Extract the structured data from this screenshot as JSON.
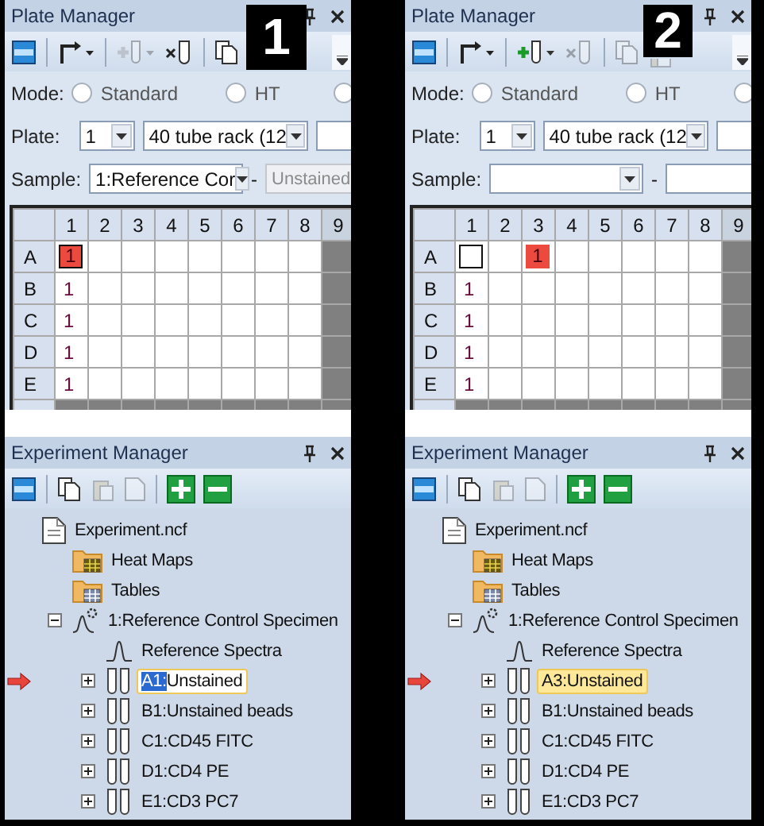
{
  "panels": [
    {
      "badge": "1",
      "plate_manager": {
        "title": "Plate Manager",
        "toolbar": [
          {
            "kind": "layout",
            "disabled": false
          },
          {
            "kind": "route",
            "disabled": false
          },
          {
            "kind": "add-tube",
            "disabled": true
          },
          {
            "kind": "remove-tube",
            "disabled": false
          },
          {
            "kind": "copy",
            "disabled": false
          }
        ],
        "mode": {
          "label": "Mode:",
          "options": [
            {
              "label": "Standard",
              "selected": false
            },
            {
              "label": "HT",
              "selected": false
            },
            {
              "selected": false
            }
          ]
        },
        "plate": {
          "label": "Plate:",
          "number": "1",
          "rack": "40 tube rack (12"
        },
        "sample": {
          "label": "Sample:",
          "value": "1:Reference Cor",
          "separator": "-",
          "tube": {
            "value": "Unstained",
            "disabled": true
          }
        },
        "grid": {
          "columns": [
            {
              "label": "1",
              "disabled": false
            },
            {
              "label": "2",
              "disabled": false
            },
            {
              "label": "3",
              "disabled": false
            },
            {
              "label": "4",
              "disabled": false
            },
            {
              "label": "5",
              "disabled": false
            },
            {
              "label": "6",
              "disabled": false
            },
            {
              "label": "7",
              "disabled": false
            },
            {
              "label": "8",
              "disabled": false
            },
            {
              "label": "9",
              "disabled": true
            }
          ],
          "rows": [
            {
              "label": "A",
              "cells": [
                {
                  "text": "1",
                  "highlighted": true,
                  "outlined": true
                },
                {
                  "highlighted": false,
                  "outlined": false
                },
                {
                  "highlighted": false,
                  "outlined": false
                },
                {
                  "highlighted": false,
                  "outlined": false
                },
                {
                  "highlighted": false,
                  "outlined": false
                },
                {
                  "highlighted": false,
                  "outlined": false
                },
                {
                  "highlighted": false,
                  "outlined": false
                },
                {
                  "highlighted": false,
                  "outlined": false
                }
              ]
            },
            {
              "label": "B",
              "cells": [
                {
                  "text": "1",
                  "highlighted": false,
                  "outlined": false
                },
                {
                  "highlighted": false,
                  "outlined": false
                },
                {
                  "highlighted": false,
                  "outlined": false
                },
                {
                  "highlighted": false,
                  "outlined": false
                },
                {
                  "highlighted": false,
                  "outlined": false
                },
                {
                  "highlighted": false,
                  "outlined": false
                },
                {
                  "highlighted": false,
                  "outlined": false
                },
                {
                  "highlighted": false,
                  "outlined": false
                }
              ]
            },
            {
              "label": "C",
              "cells": [
                {
                  "text": "1",
                  "highlighted": false,
                  "outlined": false
                },
                {
                  "highlighted": false,
                  "outlined": false
                },
                {
                  "highlighted": false,
                  "outlined": false
                },
                {
                  "highlighted": false,
                  "outlined": false
                },
                {
                  "highlighted": false,
                  "outlined": false
                },
                {
                  "highlighted": false,
                  "outlined": false
                },
                {
                  "highlighted": false,
                  "outlined": false
                },
                {
                  "highlighted": false,
                  "outlined": false
                }
              ]
            },
            {
              "label": "D",
              "cells": [
                {
                  "text": "1",
                  "highlighted": false,
                  "outlined": false
                },
                {
                  "highlighted": false,
                  "outlined": false
                },
                {
                  "highlighted": false,
                  "outlined": false
                },
                {
                  "highlighted": false,
                  "outlined": false
                },
                {
                  "highlighted": false,
                  "outlined": false
                },
                {
                  "highlighted": false,
                  "outlined": false
                },
                {
                  "highlighted": false,
                  "outlined": false
                },
                {
                  "highlighted": false,
                  "outlined": false
                }
              ]
            },
            {
              "label": "E",
              "cells": [
                {
                  "text": "1",
                  "highlighted": false,
                  "outlined": false
                },
                {
                  "highlighted": false,
                  "outlined": false
                },
                {
                  "highlighted": false,
                  "outlined": false
                },
                {
                  "highlighted": false,
                  "outlined": false
                },
                {
                  "highlighted": false,
                  "outlined": false
                },
                {
                  "highlighted": false,
                  "outlined": false
                },
                {
                  "highlighted": false,
                  "outlined": false
                },
                {
                  "highlighted": false,
                  "outlined": false
                }
              ]
            }
          ]
        }
      },
      "experiment_manager": {
        "title": "Experiment Manager",
        "toolbar": [
          {
            "kind": "layout",
            "disabled": false
          },
          {
            "kind": "copy",
            "disabled": false
          },
          {
            "kind": "paste",
            "disabled": true
          },
          {
            "kind": "document",
            "disabled": true
          },
          {
            "kind": "add",
            "disabled": false
          },
          {
            "kind": "remove",
            "disabled": false
          }
        ],
        "tree": [
          {
            "kind": "file",
            "label": "Experiment.ncf",
            "selected": false,
            "children": [
              {
                "kind": "heatmap-folder",
                "label": "Heat Maps",
                "selected": false
              },
              {
                "kind": "table-folder",
                "label": "Tables",
                "selected": false
              },
              {
                "kind": "specimen",
                "label": "1:Reference Control Specimen",
                "selected": false,
                "expanded": true,
                "children": [
                  {
                    "kind": "spectra",
                    "label": "Reference Spectra",
                    "selected": false
                  },
                  {
                    "kind": "tube",
                    "prefix": "A1:",
                    "label": "Unstained",
                    "selected": true,
                    "editing": true,
                    "expanded": false
                  },
                  {
                    "kind": "tube",
                    "prefix": "B1:",
                    "label": "Unstained beads",
                    "selected": false,
                    "editing": false,
                    "expanded": false
                  },
                  {
                    "kind": "tube",
                    "prefix": "C1:",
                    "label": "CD45 FITC",
                    "selected": false,
                    "editing": false,
                    "expanded": false
                  },
                  {
                    "kind": "tube",
                    "prefix": "D1:",
                    "label": "CD4 PE",
                    "selected": false,
                    "editing": false,
                    "expanded": false
                  },
                  {
                    "kind": "tube",
                    "prefix": "E1:",
                    "label": "CD3 PC7",
                    "selected": false,
                    "editing": false,
                    "expanded": false
                  }
                ]
              }
            ]
          }
        ]
      }
    },
    {
      "badge": "2",
      "plate_manager": {
        "title": "Plate Manager",
        "toolbar": [
          {
            "kind": "layout",
            "disabled": false
          },
          {
            "kind": "route",
            "disabled": false
          },
          {
            "kind": "add-tube",
            "disabled": false
          },
          {
            "kind": "remove-tube",
            "disabled": true
          },
          {
            "kind": "copy",
            "disabled": true
          },
          {
            "kind": "paste",
            "disabled": true
          }
        ],
        "mode": {
          "label": "Mode:",
          "options": [
            {
              "label": "Standard",
              "selected": false
            },
            {
              "label": "HT",
              "selected": false
            },
            {
              "selected": false
            }
          ]
        },
        "plate": {
          "label": "Plate:",
          "number": "1",
          "rack": "40 tube rack (12"
        },
        "sample": {
          "label": "Sample:",
          "separator": "-",
          "tube": {
            "disabled": false
          }
        },
        "grid": {
          "columns": [
            {
              "label": "1",
              "disabled": false
            },
            {
              "label": "2",
              "disabled": false
            },
            {
              "label": "3",
              "disabled": false
            },
            {
              "label": "4",
              "disabled": false
            },
            {
              "label": "5",
              "disabled": false
            },
            {
              "label": "6",
              "disabled": false
            },
            {
              "label": "7",
              "disabled": false
            },
            {
              "label": "8",
              "disabled": false
            },
            {
              "label": "9",
              "disabled": true
            }
          ],
          "rows": [
            {
              "label": "A",
              "cells": [
                {
                  "highlighted": false,
                  "outlined": true
                },
                {
                  "highlighted": false,
                  "outlined": false
                },
                {
                  "text": "1",
                  "highlighted": true,
                  "outlined": false
                },
                {
                  "highlighted": false,
                  "outlined": false
                },
                {
                  "highlighted": false,
                  "outlined": false
                },
                {
                  "highlighted": false,
                  "outlined": false
                },
                {
                  "highlighted": false,
                  "outlined": false
                },
                {
                  "highlighted": false,
                  "outlined": false
                }
              ]
            },
            {
              "label": "B",
              "cells": [
                {
                  "text": "1",
                  "highlighted": false,
                  "outlined": false
                },
                {
                  "highlighted": false,
                  "outlined": false
                },
                {
                  "highlighted": false,
                  "outlined": false
                },
                {
                  "highlighted": false,
                  "outlined": false
                },
                {
                  "highlighted": false,
                  "outlined": false
                },
                {
                  "highlighted": false,
                  "outlined": false
                },
                {
                  "highlighted": false,
                  "outlined": false
                },
                {
                  "highlighted": false,
                  "outlined": false
                }
              ]
            },
            {
              "label": "C",
              "cells": [
                {
                  "text": "1",
                  "highlighted": false,
                  "outlined": false
                },
                {
                  "highlighted": false,
                  "outlined": false
                },
                {
                  "highlighted": false,
                  "outlined": false
                },
                {
                  "highlighted": false,
                  "outlined": false
                },
                {
                  "highlighted": false,
                  "outlined": false
                },
                {
                  "highlighted": false,
                  "outlined": false
                },
                {
                  "highlighted": false,
                  "outlined": false
                },
                {
                  "highlighted": false,
                  "outlined": false
                }
              ]
            },
            {
              "label": "D",
              "cells": [
                {
                  "text": "1",
                  "highlighted": false,
                  "outlined": false
                },
                {
                  "highlighted": false,
                  "outlined": false
                },
                {
                  "highlighted": false,
                  "outlined": false
                },
                {
                  "highlighted": false,
                  "outlined": false
                },
                {
                  "highlighted": false,
                  "outlined": false
                },
                {
                  "highlighted": false,
                  "outlined": false
                },
                {
                  "highlighted": false,
                  "outlined": false
                },
                {
                  "highlighted": false,
                  "outlined": false
                }
              ]
            },
            {
              "label": "E",
              "cells": [
                {
                  "text": "1",
                  "highlighted": false,
                  "outlined": false
                },
                {
                  "highlighted": false,
                  "outlined": false
                },
                {
                  "highlighted": false,
                  "outlined": false
                },
                {
                  "highlighted": false,
                  "outlined": false
                },
                {
                  "highlighted": false,
                  "outlined": false
                },
                {
                  "highlighted": false,
                  "outlined": false
                },
                {
                  "highlighted": false,
                  "outlined": false
                },
                {
                  "highlighted": false,
                  "outlined": false
                }
              ]
            }
          ]
        }
      },
      "experiment_manager": {
        "title": "Experiment Manager",
        "toolbar": [
          {
            "kind": "layout",
            "disabled": false
          },
          {
            "kind": "copy",
            "disabled": false
          },
          {
            "kind": "paste",
            "disabled": true
          },
          {
            "kind": "document",
            "disabled": true
          },
          {
            "kind": "add",
            "disabled": false
          },
          {
            "kind": "remove",
            "disabled": false
          }
        ],
        "tree": [
          {
            "kind": "file",
            "label": "Experiment.ncf",
            "selected": false,
            "children": [
              {
                "kind": "heatmap-folder",
                "label": "Heat Maps",
                "selected": false
              },
              {
                "kind": "table-folder",
                "label": "Tables",
                "selected": false
              },
              {
                "kind": "specimen",
                "label": "1:Reference Control Specimen",
                "selected": false,
                "expanded": true,
                "children": [
                  {
                    "kind": "spectra",
                    "label": "Reference Spectra",
                    "selected": false
                  },
                  {
                    "kind": "tube",
                    "prefix": "A3:",
                    "label": "Unstained",
                    "selected": true,
                    "editing": false,
                    "expanded": false
                  },
                  {
                    "kind": "tube",
                    "prefix": "B1:",
                    "label": "Unstained beads",
                    "selected": false,
                    "editing": false,
                    "expanded": false
                  },
                  {
                    "kind": "tube",
                    "prefix": "C1:",
                    "label": "CD45 FITC",
                    "selected": false,
                    "editing": false,
                    "expanded": false
                  },
                  {
                    "kind": "tube",
                    "prefix": "D1:",
                    "label": "CD4 PE",
                    "selected": false,
                    "editing": false,
                    "expanded": false
                  },
                  {
                    "kind": "tube",
                    "prefix": "E1:",
                    "label": "CD3 PC7",
                    "selected": false,
                    "editing": false,
                    "expanded": false
                  }
                ]
              }
            ]
          }
        ]
      }
    }
  ]
}
